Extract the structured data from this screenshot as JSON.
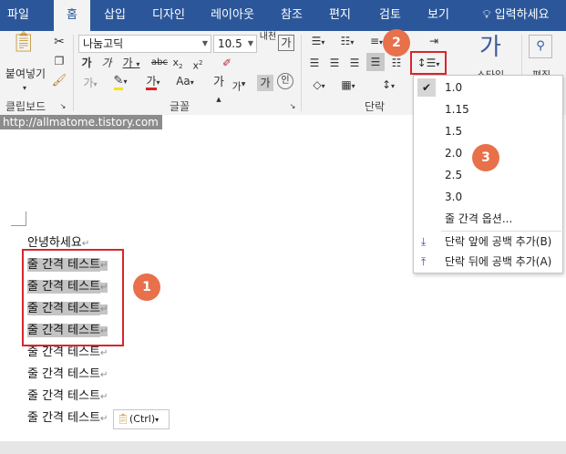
{
  "tabs": [
    "파일",
    "홈",
    "삽입",
    "디자인",
    "레이아웃",
    "참조",
    "편지",
    "검토",
    "보기"
  ],
  "tell_me": "입력하세요",
  "clipboard": {
    "paste_label": "붙여넣기",
    "group_label": "클립보드"
  },
  "font": {
    "name": "나눔고딕",
    "size": "10.5",
    "group_label": "글꼴",
    "phonetic": "내천",
    "char_border": "가"
  },
  "paragraph": {
    "group_label": "단락"
  },
  "styles": {
    "label": "스타일",
    "glyph": "가"
  },
  "editing": {
    "label": "편집"
  },
  "url_watermark": "http://allmatome.tistory.com",
  "doc_lines": [
    "안녕하세요",
    "줄 간격 테스트",
    "줄 간격 테스트",
    "줄 간격 테스트",
    "줄 간격 테스트",
    "줄 간격 테스트",
    "줄 간격 테스트",
    "줄 간격 테스트",
    "줄 간격 테스트"
  ],
  "paste_options": "(Ctrl)",
  "line_spacing_menu": {
    "options": [
      "1.0",
      "1.15",
      "1.5",
      "2.0",
      "2.5",
      "3.0"
    ],
    "checked": "1.0",
    "more": "줄 간격 옵션...",
    "add_before": "단락 앞에 공백 추가(B)",
    "add_after": "단락 뒤에 공백 추가(A)"
  },
  "badges": [
    "1",
    "2",
    "3"
  ],
  "colors": {
    "tabbar": "#2b579a",
    "badge": "#e8704a",
    "highlight": "#d9262b",
    "selection": "#c4c4c4"
  }
}
